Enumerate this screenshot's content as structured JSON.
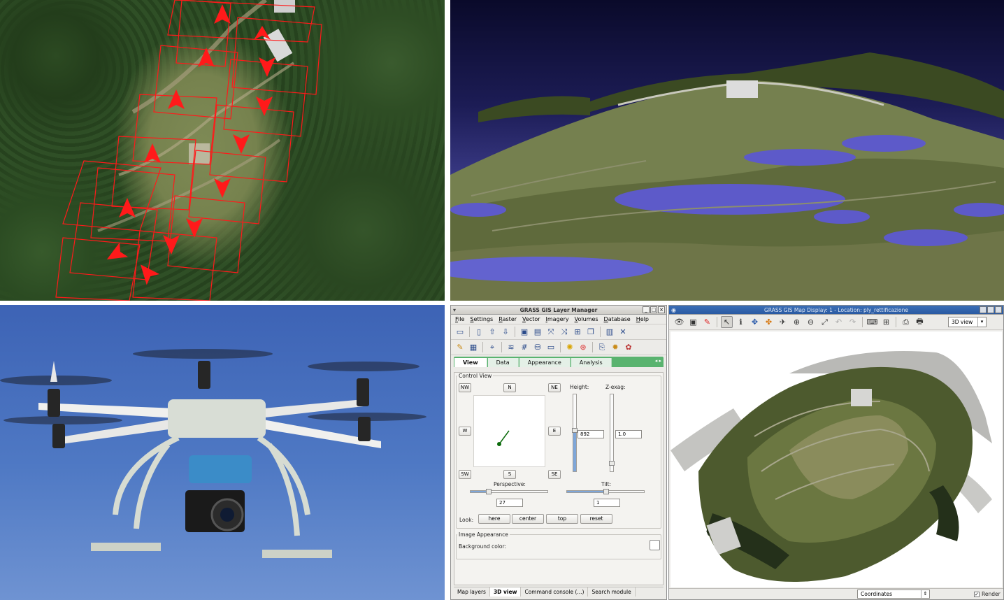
{
  "layer_manager": {
    "title": "GRASS GIS Layer Manager",
    "menu": [
      "File",
      "Settings",
      "Raster",
      "Vector",
      "Imagery",
      "Volumes",
      "Database",
      "Help"
    ],
    "tabs": [
      "View",
      "Data",
      "Appearance",
      "Analysis"
    ],
    "control_view": {
      "group_title": "Control View",
      "directions": {
        "nw": "NW",
        "n": "N",
        "ne": "NE",
        "w": "W",
        "e": "E",
        "sw": "SW",
        "s": "S",
        "se": "SE"
      },
      "height_label": "Height:",
      "height_value": "892",
      "zexag_label": "Z-exag:",
      "zexag_value": "1.0",
      "perspective_label": "Perspective:",
      "perspective_value": "27",
      "tilt_label": "Tilt:",
      "tilt_value": "1",
      "look_label": "Look:",
      "look_buttons": [
        "here",
        "center",
        "top",
        "reset"
      ]
    },
    "image_appearance": {
      "group_title": "Image Appearance",
      "background_label": "Background color:",
      "background_color": "#ffffff"
    },
    "bottom_tabs": [
      "Map layers",
      "3D view",
      "Command console (...)",
      "Search module"
    ],
    "active_bottom_tab": "3D view"
  },
  "map_display": {
    "title": "GRASS GIS Map Display: 1 - Location: ply_rettificazione",
    "view_mode": "3D view",
    "status_mode": "Coordinates",
    "render_label": "Render",
    "render_checked": true
  },
  "icons": {
    "layer_manager_toolbar": [
      "new-display-icon",
      "workspace-new-icon",
      "workspace-open-icon",
      "workspace-save-icon",
      "add-raster-icon",
      "add-raster-multi-icon",
      "add-vector-icon",
      "add-vector-multi-icon",
      "add-overlay-icon",
      "add-group-icon",
      "remove-layer-icon",
      "layer-props-icon",
      "remove-icon",
      "edit-vector-icon",
      "attribute-table-icon",
      "georectify-icon",
      "cartographic-composer-icon",
      "raster-calc-icon",
      "model-builder-icon",
      "graphical-modeler-icon",
      "settings-icon",
      "help-icon",
      "script-icon",
      "tools-icon",
      "close-icon"
    ],
    "map_display_toolbar": [
      "display-map-icon",
      "render-map-icon",
      "erase-icon",
      "pointer-icon",
      "query-icon",
      "pan-icon",
      "zoom-in-icon",
      "zoom-out-icon",
      "zoom-extent-icon",
      "zoom-back-icon",
      "zoom-menu-icon",
      "analyze-icon",
      "overlay-icon",
      "save-icon",
      "print-icon"
    ]
  },
  "colors": {
    "tab_strip": "#59b36f",
    "map_titlebar": "#2a5aa2",
    "flight_path": "#ff0000"
  }
}
